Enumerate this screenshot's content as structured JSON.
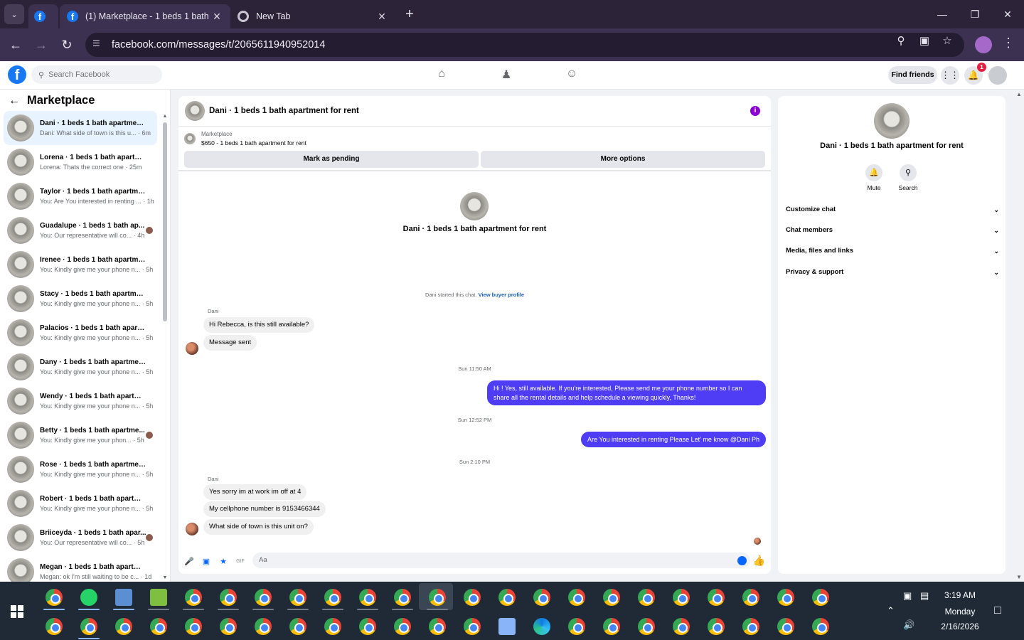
{
  "browser": {
    "tabs": [
      {
        "title": "(1) Marketplace - 1 beds 1 bath",
        "favicon": "facebook-icon"
      },
      {
        "title": "New Tab",
        "favicon": "chrome-icon"
      }
    ],
    "url": "facebook.com/messages/t/2065611940952014"
  },
  "header": {
    "search_placeholder": "Search Facebook",
    "find_friends": "Find friends",
    "notification_count": "1"
  },
  "sidebar": {
    "title": "Marketplace",
    "conversations": [
      {
        "name": "Dani · 1 beds 1 bath apartment ...",
        "preview": "Dani: What side of town is this u... · 6m",
        "selected": true,
        "has_seen_avatar": false
      },
      {
        "name": "Lorena · 1 beds 1 bath apartme...",
        "preview": "Lorena: Thats the correct one · 25m",
        "selected": false,
        "has_seen_avatar": false
      },
      {
        "name": "Taylor · 1 beds 1 bath apartmen...",
        "preview": "You: Are You interested in renting ... · 1h",
        "selected": false,
        "has_seen_avatar": false
      },
      {
        "name": "Guadalupe · 1 beds 1 bath ap...",
        "preview": "You: Our representative will co... · 4h",
        "selected": false,
        "has_seen_avatar": true
      },
      {
        "name": "Irenee · 1 beds 1 bath apartmen...",
        "preview": "You: Kindly give me your phone n... · 5h",
        "selected": false,
        "has_seen_avatar": false
      },
      {
        "name": "Stacy · 1 beds 1 bath apartment...",
        "preview": "You: Kindly give me your phone n... · 5h",
        "selected": false,
        "has_seen_avatar": false
      },
      {
        "name": "Palacios · 1 beds 1 bath apartm...",
        "preview": "You: Kindly give me your phone n... · 5h",
        "selected": false,
        "has_seen_avatar": false
      },
      {
        "name": "Dany · 1 beds 1 bath apartment...",
        "preview": "You: Kindly give me your phone n... · 5h",
        "selected": false,
        "has_seen_avatar": false
      },
      {
        "name": "Wendy · 1 beds 1 bath apartme...",
        "preview": "You: Kindly give me your phone n... · 5h",
        "selected": false,
        "has_seen_avatar": false
      },
      {
        "name": "Betty · 1 beds 1 bath apartme...",
        "preview": "You: Kindly give me your phon... · 5h",
        "selected": false,
        "has_seen_avatar": true
      },
      {
        "name": "Rose · 1 beds 1 bath apartment ...",
        "preview": "You: Kindly give me your phone n... · 5h",
        "selected": false,
        "has_seen_avatar": false
      },
      {
        "name": "Robert · 1 beds 1 bath apartme...",
        "preview": "You: Kindly give me your phone n... · 5h",
        "selected": false,
        "has_seen_avatar": false
      },
      {
        "name": "Briiceyda · 1 beds 1 bath apar...",
        "preview": "You: Our representative will co... · 5h",
        "selected": false,
        "has_seen_avatar": true
      },
      {
        "name": "Megan · 1 beds 1 bath apartme...",
        "preview": "Megan: ok I'm still waiting to be c... · 1d",
        "selected": false,
        "has_seen_avatar": false
      }
    ]
  },
  "chat": {
    "title": "Dani · 1 beds 1 bath apartment for rent",
    "listing_kind": "Marketplace",
    "listing_price": "$650 - 1 beds 1 bath apartment for rent",
    "mark_pending": "Mark as pending",
    "more_options": "More options",
    "intro_name": "Dani · 1 beds 1 bath apartment for rent",
    "started_text": "Dani started this chat.",
    "view_buyer_profile": "View buyer profile",
    "sender_name": "Dani",
    "msg_in_1": "Hi Rebecca, is this still available?",
    "msg_in_2": "Message sent",
    "time_1": "Sun 11:50 AM",
    "msg_out_1": "Hi ! Yes, still available. If you're interested, Please send me your phone number so I can share all the rental details and help schedule a viewing quickly, Thanks!",
    "time_2": "Sun 12:52 PM",
    "msg_out_2": "Are You  interested in renting Please Let' me know @Dani Ph",
    "time_3": "Sun 2:10 PM",
    "msg_in_3": "Yes sorry im at work im off at 4",
    "msg_in_4": "My cellphone number is 9153466344",
    "msg_in_5": "What side of town is this unit on?",
    "composer_placeholder": "Aa",
    "accent_color": "#4f3df5"
  },
  "info_panel": {
    "name": "Dani · 1 beds 1 bath apartment for rent",
    "mute": "Mute",
    "search": "Search",
    "sections": [
      "Customize chat",
      "Chat members",
      "Media, files and links",
      "Privacy & support"
    ]
  },
  "taskbar": {
    "time": "3:19 AM",
    "day": "Monday",
    "date": "2/16/2026"
  }
}
